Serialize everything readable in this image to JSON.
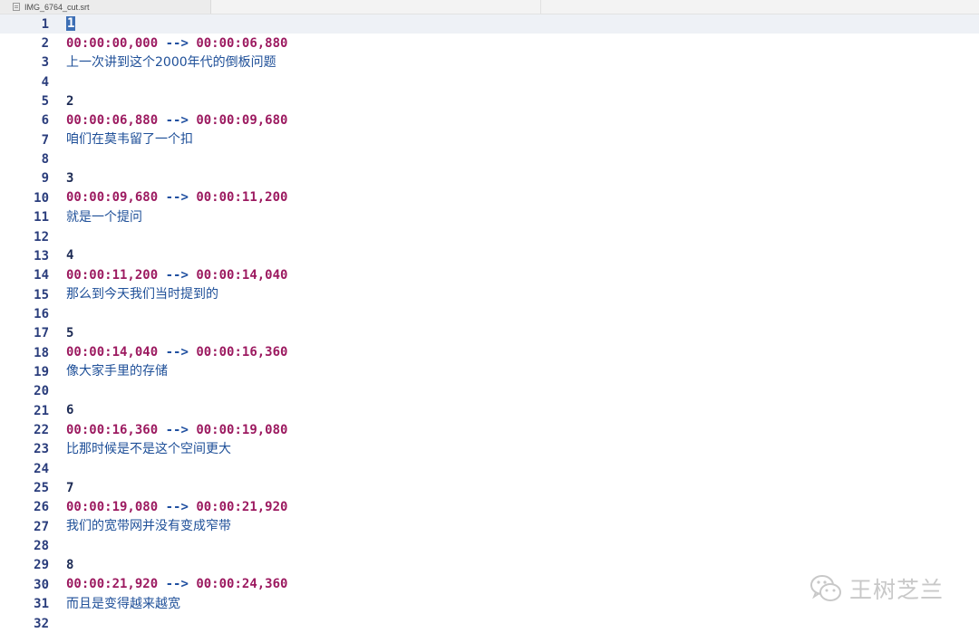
{
  "tab": {
    "filename": "IMG_6764_cut.srt"
  },
  "editor": {
    "lines": [
      {
        "n": "1",
        "type": "num",
        "text": "1",
        "current": true
      },
      {
        "n": "2",
        "type": "ts",
        "start": "00:00:00,000",
        "arrow": "-->",
        "end": "00:00:06,880"
      },
      {
        "n": "3",
        "type": "txt",
        "text": "上一次讲到这个2000年代的倒板问题"
      },
      {
        "n": "4",
        "type": "blank",
        "text": ""
      },
      {
        "n": "5",
        "type": "num",
        "text": "2"
      },
      {
        "n": "6",
        "type": "ts",
        "start": "00:00:06,880",
        "arrow": "-->",
        "end": "00:00:09,680"
      },
      {
        "n": "7",
        "type": "txt",
        "text": "咱们在莫韦留了一个扣"
      },
      {
        "n": "8",
        "type": "blank",
        "text": ""
      },
      {
        "n": "9",
        "type": "num",
        "text": "3"
      },
      {
        "n": "10",
        "type": "ts",
        "start": "00:00:09,680",
        "arrow": "-->",
        "end": "00:00:11,200"
      },
      {
        "n": "11",
        "type": "txt",
        "text": "就是一个提问"
      },
      {
        "n": "12",
        "type": "blank",
        "text": ""
      },
      {
        "n": "13",
        "type": "num",
        "text": "4"
      },
      {
        "n": "14",
        "type": "ts",
        "start": "00:00:11,200",
        "arrow": "-->",
        "end": "00:00:14,040"
      },
      {
        "n": "15",
        "type": "txt",
        "text": "那么到今天我们当时提到的"
      },
      {
        "n": "16",
        "type": "blank",
        "text": ""
      },
      {
        "n": "17",
        "type": "num",
        "text": "5"
      },
      {
        "n": "18",
        "type": "ts",
        "start": "00:00:14,040",
        "arrow": "-->",
        "end": "00:00:16,360"
      },
      {
        "n": "19",
        "type": "txt",
        "text": "像大家手里的存储"
      },
      {
        "n": "20",
        "type": "blank",
        "text": ""
      },
      {
        "n": "21",
        "type": "num",
        "text": "6"
      },
      {
        "n": "22",
        "type": "ts",
        "start": "00:00:16,360",
        "arrow": "-->",
        "end": "00:00:19,080"
      },
      {
        "n": "23",
        "type": "txt",
        "text": "比那时候是不是这个空间更大"
      },
      {
        "n": "24",
        "type": "blank",
        "text": ""
      },
      {
        "n": "25",
        "type": "num",
        "text": "7"
      },
      {
        "n": "26",
        "type": "ts",
        "start": "00:00:19,080",
        "arrow": "-->",
        "end": "00:00:21,920"
      },
      {
        "n": "27",
        "type": "txt",
        "text": "我们的宽带网并没有变成窄带"
      },
      {
        "n": "28",
        "type": "blank",
        "text": ""
      },
      {
        "n": "29",
        "type": "num",
        "text": "8"
      },
      {
        "n": "30",
        "type": "ts",
        "start": "00:00:21,920",
        "arrow": "-->",
        "end": "00:00:24,360"
      },
      {
        "n": "31",
        "type": "txt",
        "text": "而且是变得越来越宽"
      },
      {
        "n": "32",
        "type": "blank",
        "text": ""
      }
    ]
  },
  "watermark": {
    "text": "王树芝兰",
    "icon": "wechat-icon"
  },
  "colors": {
    "line_number": "#2a3d7c",
    "timestamp": "#9c1a60",
    "arrow": "#1f4fa0",
    "subtitle_text": "#1e4f98",
    "current_line_bg": "#eef1f6",
    "selection": "#3d6fb5"
  }
}
